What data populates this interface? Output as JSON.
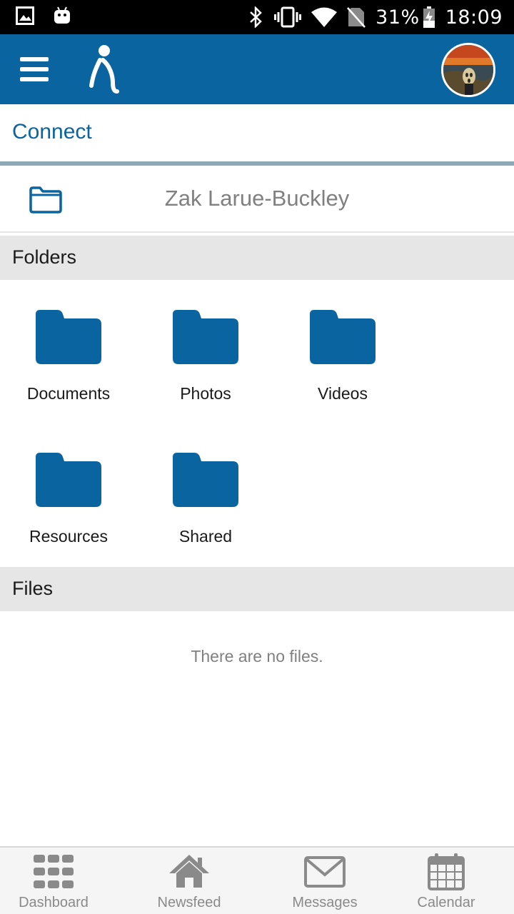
{
  "status_bar": {
    "battery": "31%",
    "time": "18:09",
    "icons": [
      "image-icon",
      "android-icon",
      "bluetooth-icon",
      "vibrate-icon",
      "wifi-icon",
      "no-sim-icon",
      "battery-charging-icon"
    ]
  },
  "app_bar": {
    "menu_icon": "hamburger-menu-icon",
    "logo_icon": "person-logo-icon",
    "avatar_icon": "user-avatar"
  },
  "page": {
    "title": "Connect"
  },
  "user_row": {
    "icon": "folder-outline-icon",
    "name": "Zak Larue-Buckley"
  },
  "folders": {
    "header": "Folders",
    "items": [
      {
        "label": "Documents",
        "icon": "folder-icon"
      },
      {
        "label": "Photos",
        "icon": "folder-icon"
      },
      {
        "label": "Videos",
        "icon": "folder-icon"
      },
      {
        "label": "Resources",
        "icon": "folder-icon"
      },
      {
        "label": "Shared",
        "icon": "folder-icon"
      }
    ]
  },
  "files": {
    "header": "Files",
    "empty_message": "There are no files."
  },
  "bottom_nav": {
    "items": [
      {
        "label": "Dashboard",
        "icon": "grid-icon"
      },
      {
        "label": "Newsfeed",
        "icon": "home-icon"
      },
      {
        "label": "Messages",
        "icon": "envelope-icon"
      },
      {
        "label": "Calendar",
        "icon": "calendar-icon"
      }
    ]
  },
  "colors": {
    "brand": "#0a64a0",
    "section_bg": "#e6e6e6",
    "muted_text": "#808080"
  }
}
